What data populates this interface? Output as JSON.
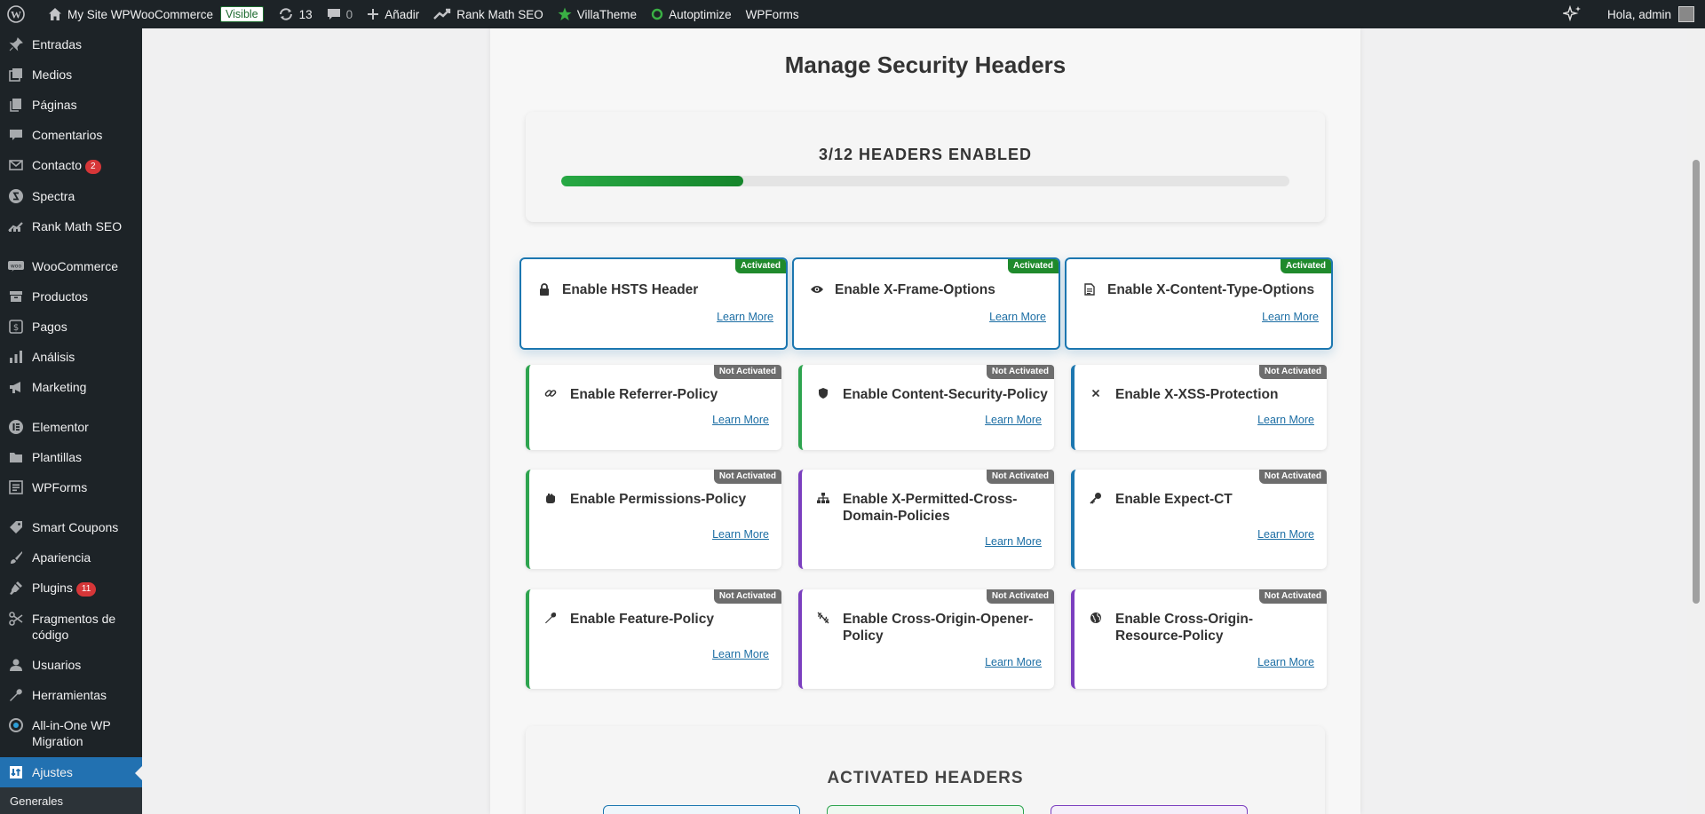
{
  "adminbar": {
    "site_name": "My Site WPWooCommerce",
    "visible_badge": "Visible",
    "updates_count": "13",
    "comments_count": "0",
    "new_label": "Añadir",
    "rankmath_label": "Rank Math SEO",
    "villatheme_label": "VillaTheme",
    "autoptimize_label": "Autoptimize",
    "wpforms_label": "WPForms",
    "greeting": "Hola, admin"
  },
  "sidebar": {
    "items": [
      {
        "label": "Entradas",
        "icon": "pin-icon"
      },
      {
        "label": "Medios",
        "icon": "media-icon"
      },
      {
        "label": "Páginas",
        "icon": "pages-icon"
      },
      {
        "label": "Comentarios",
        "icon": "comment-icon"
      },
      {
        "label": "Contacto",
        "icon": "mail-icon",
        "badge": "2"
      },
      {
        "label": "Spectra",
        "icon": "spectra-icon"
      },
      {
        "label": "Rank Math SEO",
        "icon": "rankmath-icon"
      },
      {
        "label": "WooCommerce",
        "icon": "woo-icon"
      },
      {
        "label": "Productos",
        "icon": "archive-icon"
      },
      {
        "label": "Pagos",
        "icon": "money-icon"
      },
      {
        "label": "Análisis",
        "icon": "chart-icon"
      },
      {
        "label": "Marketing",
        "icon": "megaphone-icon"
      },
      {
        "label": "Elementor",
        "icon": "elementor-icon"
      },
      {
        "label": "Plantillas",
        "icon": "folder-icon"
      },
      {
        "label": "WPForms",
        "icon": "forms-icon"
      },
      {
        "label": "Smart Coupons",
        "icon": "tag-icon"
      },
      {
        "label": "Apariencia",
        "icon": "brush-icon"
      },
      {
        "label": "Plugins",
        "icon": "plugin-icon",
        "badge": "11"
      },
      {
        "label": "Fragmentos de código",
        "icon": "scissors-icon"
      },
      {
        "label": "Usuarios",
        "icon": "user-icon"
      },
      {
        "label": "Herramientas",
        "icon": "wrench-icon"
      },
      {
        "label": "All-in-One WP Migration",
        "icon": "migration-icon"
      },
      {
        "label": "Ajustes",
        "icon": "settings-icon"
      }
    ],
    "submenu_first": "Generales"
  },
  "main": {
    "title": "Manage Security Headers",
    "progress_text": "3/12 HEADERS ENABLED",
    "progress_fraction": 0.25,
    "learn_more": "Learn More",
    "status_on": "Activated",
    "status_off": "Not Activated",
    "cards": [
      {
        "title": "Enable HSTS Header",
        "icon": "lock-icon",
        "active": true
      },
      {
        "title": "Enable X-Frame-Options",
        "icon": "eye-icon",
        "active": true
      },
      {
        "title": "Enable X-Content-Type-Options",
        "icon": "document-icon",
        "active": true
      },
      {
        "title": "Enable Referrer-Policy",
        "icon": "link-icon",
        "active": false
      },
      {
        "title": "Enable Content-Security-Policy",
        "icon": "shield-icon",
        "active": false
      },
      {
        "title": "Enable X-XSS-Protection",
        "icon": "close-icon",
        "active": false
      },
      {
        "title": "Enable Permissions-Policy",
        "icon": "hand-icon",
        "active": false
      },
      {
        "title": "Enable X-Permitted-Cross-Domain-Policies",
        "icon": "sitemap-icon",
        "active": false
      },
      {
        "title": "Enable Expect-CT",
        "icon": "key-icon",
        "active": false
      },
      {
        "title": "Enable Feature-Policy",
        "icon": "wrench-icon",
        "active": false
      },
      {
        "title": "Enable Cross-Origin-Opener-Policy",
        "icon": "unlink-icon",
        "active": false
      },
      {
        "title": "Enable Cross-Origin-Resource-Policy",
        "icon": "globe-icon",
        "active": false
      }
    ],
    "activated_title": "ACTIVATED HEADERS"
  },
  "colors": {
    "accent_blue": "#1c77b0",
    "green": "#2ea44f",
    "purple": "#7b3fbf",
    "badge_on": "#1f8a2c",
    "badge_off": "#6d6d6d"
  }
}
